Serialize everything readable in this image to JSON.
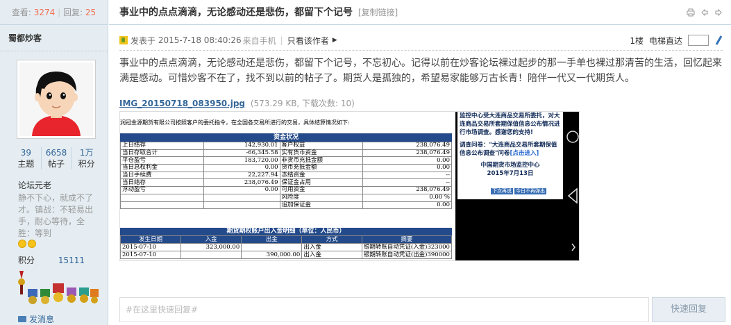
{
  "sidebar": {
    "views_label": "查看:",
    "views": "3274",
    "replies_label": "回复:",
    "replies": "25",
    "author": "蜀都炒客",
    "stats": [
      {
        "num": "39",
        "label": "主题"
      },
      {
        "num": "6658",
        "label": "帖子"
      },
      {
        "num": "1万",
        "label": "积分"
      }
    ],
    "rank": "论坛元老",
    "signature": "静不下心，就成不了才。镇战：不轻易出手，耐心等待，全胜：等到",
    "credit_label": "积分",
    "credit_value": "15111",
    "pm": "发消息"
  },
  "thread": {
    "title": "事业中的点点滴滴，无论感动还是悲伤，都留下个记号",
    "copy_link": "[复制链接]",
    "posted_prefix": "发表于",
    "posted_time": "2015-7-18 08:40:26",
    "from": "来自手机",
    "sep": "|",
    "author_only": "只看该作者",
    "floor": "1楼",
    "floor_jump": "电梯直达",
    "body": "事业中的点点滴滴，无论感动还是悲伤，都留下个记号，不忘初心。记得以前在炒客论坛裸过起步的那一手单也裸过那清苦的生活，回忆起来满是感动。可惜炒客不在了，找不到以前的帖子了。期货人是孤独的，希望易家能够万古长青！陪伴一代又一代期货人。",
    "attachment": {
      "name": "IMG_20150718_083950.jpg",
      "info": "(573.29 KB, 下载次数: 10)"
    }
  },
  "screenshot": {
    "notice": "润冠金源期货有限公司按照客户的委托指令，在全国各交易所进行的交易，具体结算情况如下:",
    "fund_title": "资金状况",
    "fund_rows": [
      [
        "上日结存",
        "142,930.01",
        "客户权益",
        "238,076.49"
      ],
      [
        "当日存取合计",
        "-66,345.58",
        "实有货币资金",
        "238,076.49"
      ],
      [
        "平仓盈亏",
        "183,720.00",
        "非货币充抵金额",
        "0.00"
      ],
      [
        "当日总权利金",
        "0.00",
        "货币充抵金额",
        "0.00"
      ],
      [
        "当日手续费",
        "22,227.94",
        "冻结资金",
        "--"
      ],
      [
        "当日结存",
        "238,076.49",
        "保证金占用",
        "--"
      ],
      [
        "浮动盈亏",
        "0.00",
        "可用资金",
        "238,076.49"
      ],
      [
        "",
        "",
        "风险度",
        "0.00 %"
      ],
      [
        "",
        "",
        "追加保证金",
        "0.00"
      ]
    ],
    "flow_title": "期货期权账户出入金明细（单位：人民币）",
    "flow_headers": [
      "发生日期",
      "入金",
      "出金",
      "方式",
      "摘要"
    ],
    "flow_rows": [
      [
        "2015-07-10",
        "323,000.00",
        "",
        "出入金",
        "银期转账自动凭证(入金)323000"
      ],
      [
        "2015-07-10",
        "",
        "390,000.00",
        "出入金",
        "银期转账自动凭证(出金)390000"
      ]
    ],
    "dialog_line1": "监控中心受大连商品交易所委托，对大连商品交易所套期保值信息公布情况进行市场调查。感谢您的支持!",
    "dialog_line2a": "调查问卷：\"大连商品交易所套期保值信息公布调查\"问卷",
    "dialog_link": "[点击进入]",
    "dialog_org": "中国期货市场监控中心",
    "dialog_date": "2015年7月13日",
    "btn_next": "下次再说",
    "btn_never": "今日不再弹出"
  },
  "reply": {
    "placeholder": "#在这里快速回复#",
    "button": "快速回复"
  }
}
